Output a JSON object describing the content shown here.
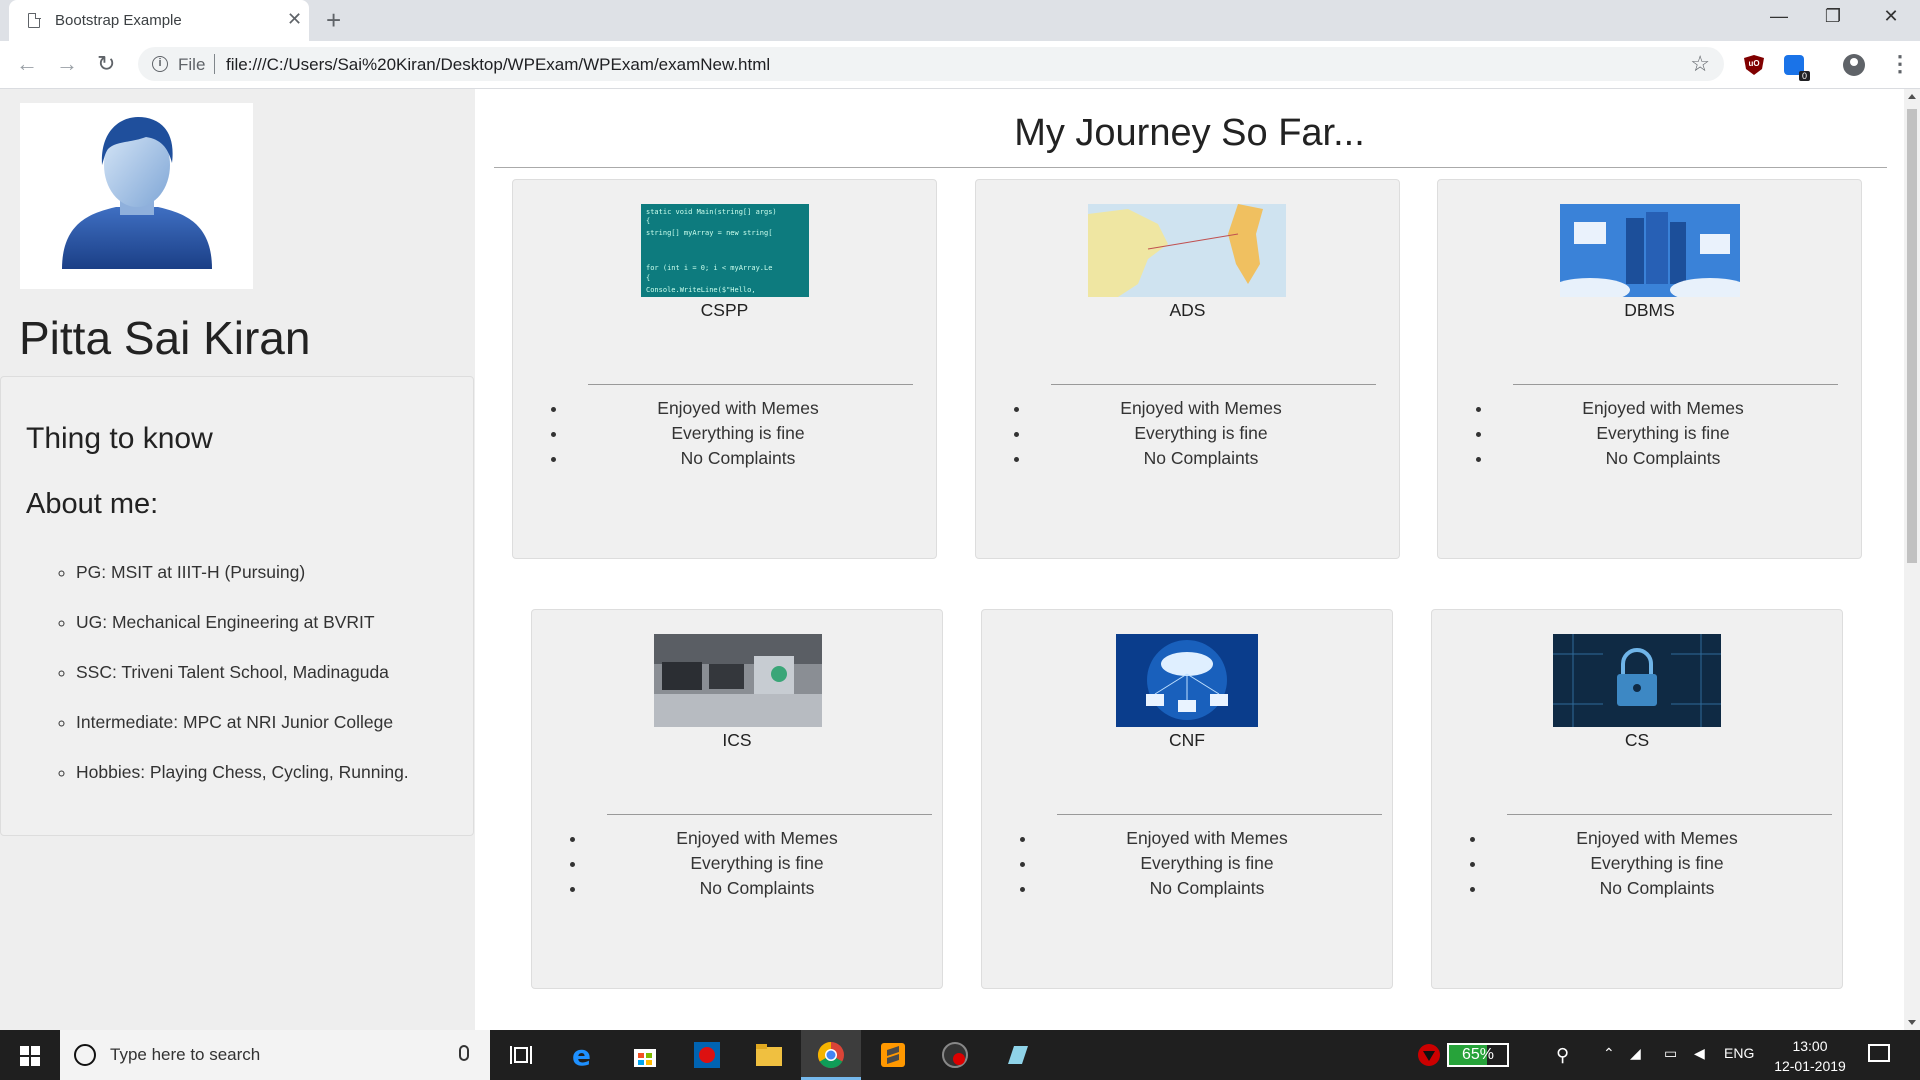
{
  "browser": {
    "tab_title": "Bootstrap Example",
    "tab_close": "✕",
    "new_tab": "+",
    "url_scheme": "File",
    "url": "file:///C:/Users/Sai%20Kiran/Desktop/WPExam/WPExam/examNew.html",
    "extension_badge": "0",
    "window_controls": {
      "minimize": "—",
      "maximize": "❐",
      "close": "✕"
    },
    "nav": {
      "back": "←",
      "forward": "→",
      "reload": "↻",
      "star": "☆",
      "menu": "⋮"
    }
  },
  "sidebar": {
    "name": "Pitta Sai Kiran",
    "heading": "Thing to know",
    "subheading": "About me:",
    "items": [
      "PG: MSIT at IIIT-H (Pursuing)",
      "UG: Mechanical Engineering at BVRIT",
      "SSC: Triveni Talent School, Madinaguda",
      "Intermediate: MPC at NRI Junior College",
      "Hobbies: Playing Chess, Cycling, Running."
    ]
  },
  "main": {
    "title": "My Journey So Far...",
    "cards": [
      {
        "title": "CSPP",
        "bullets": [
          "Enjoyed with Memes",
          "Everything is fine",
          "No Complaints"
        ]
      },
      {
        "title": "ADS",
        "bullets": [
          "Enjoyed with Memes",
          "Everything is fine",
          "No Complaints"
        ]
      },
      {
        "title": "DBMS",
        "bullets": [
          "Enjoyed with Memes",
          "Everything is fine",
          "No Complaints"
        ]
      },
      {
        "title": "ICS",
        "bullets": [
          "Enjoyed with Memes",
          "Everything is fine",
          "No Complaints"
        ]
      },
      {
        "title": "CNF",
        "bullets": [
          "Enjoyed with Memes",
          "Everything is fine",
          "No Complaints"
        ]
      },
      {
        "title": "CS",
        "bullets": [
          "Enjoyed with Memes",
          "Everything is fine",
          "No Complaints"
        ]
      }
    ],
    "code_snippet": [
      "static void Main(string[] args)",
      "{",
      "    string[] myArray = new string[",
      "",
      "    for (int i = 0; i < myArray.Le",
      "    {",
      "        Console.WriteLine($\"Hello,"
    ]
  },
  "taskbar": {
    "search_placeholder": "Type here to search",
    "battery": "65%",
    "battery_level": 0.65,
    "language": "ENG",
    "time": "13:00",
    "date": "12-01-2019"
  }
}
